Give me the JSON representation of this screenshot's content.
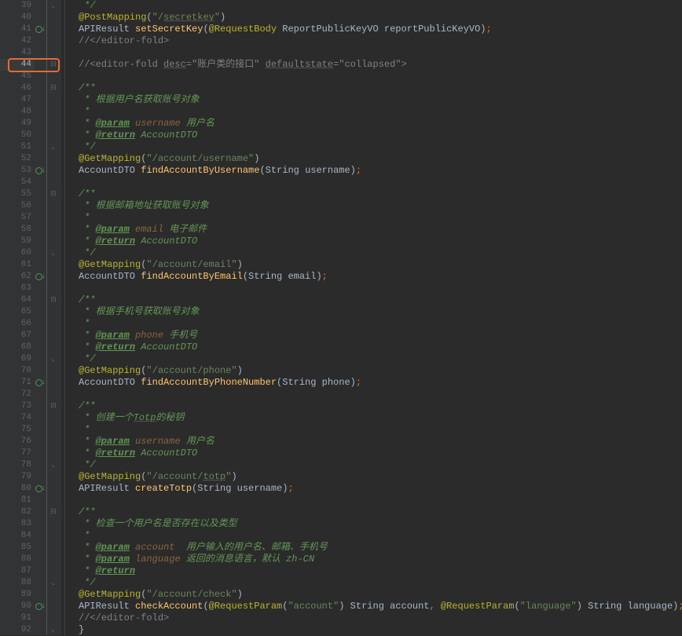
{
  "highlighted_line": 44,
  "lines": [
    {
      "n": 39,
      "fold": "end",
      "indent": 2,
      "tokens": [
        {
          "t": " */",
          "c": "c-doc"
        }
      ]
    },
    {
      "n": 40,
      "marker": false,
      "indent": 1,
      "tokens": [
        {
          "t": "@PostMapping",
          "c": "c-anno"
        },
        {
          "t": "(",
          "c": ""
        },
        {
          "t": "\"/",
          "c": "c-string"
        },
        {
          "t": "secretkey",
          "c": "c-string c-underline"
        },
        {
          "t": "\"",
          "c": "c-string"
        },
        {
          "t": ")",
          "c": ""
        }
      ]
    },
    {
      "n": 41,
      "marker": true,
      "indent": 1,
      "tokens": [
        {
          "t": "APIResult ",
          "c": ""
        },
        {
          "t": "setSecretKey",
          "c": "c-method"
        },
        {
          "t": "(",
          "c": ""
        },
        {
          "t": "@RequestBody",
          "c": "c-anno"
        },
        {
          "t": " ReportPublicKeyVO reportPublicKeyVO)",
          "c": ""
        },
        {
          "t": ";",
          "c": "c-sc"
        }
      ]
    },
    {
      "n": 42,
      "indent": 1,
      "tokens": [
        {
          "t": "//</editor-fold>",
          "c": "c-comment"
        }
      ]
    },
    {
      "n": 43,
      "indent": 1,
      "tokens": []
    },
    {
      "n": 44,
      "fold": "start",
      "indent": 1,
      "tokens": [
        {
          "t": "//<editor-fold ",
          "c": "c-comment"
        },
        {
          "t": "desc",
          "c": "c-comment c-underline"
        },
        {
          "t": "=\"账户类的接口\" ",
          "c": "c-comment"
        },
        {
          "t": "defaultstate",
          "c": "c-comment c-underline"
        },
        {
          "t": "=\"collapsed\">",
          "c": "c-comment"
        }
      ]
    },
    {
      "n": 45,
      "indent": 1,
      "tokens": []
    },
    {
      "n": 46,
      "fold": "start",
      "indent": 1,
      "tokens": [
        {
          "t": "/**",
          "c": "c-doc"
        }
      ]
    },
    {
      "n": 47,
      "indent": 2,
      "tokens": [
        {
          "t": " * 根据用户名获取账号对象",
          "c": "c-doc"
        }
      ]
    },
    {
      "n": 48,
      "indent": 2,
      "tokens": [
        {
          "t": " *",
          "c": "c-doc"
        }
      ]
    },
    {
      "n": 49,
      "indent": 2,
      "tokens": [
        {
          "t": " * ",
          "c": "c-doc"
        },
        {
          "t": "@param",
          "c": "c-doctag"
        },
        {
          "t": " ",
          "c": "c-doc"
        },
        {
          "t": "username",
          "c": "c-docparam"
        },
        {
          "t": " 用户名",
          "c": "c-doc"
        }
      ]
    },
    {
      "n": 50,
      "indent": 2,
      "tokens": [
        {
          "t": " * ",
          "c": "c-doc"
        },
        {
          "t": "@return",
          "c": "c-doctag"
        },
        {
          "t": " AccountDTO",
          "c": "c-doc"
        }
      ]
    },
    {
      "n": 51,
      "fold": "end",
      "indent": 2,
      "tokens": [
        {
          "t": " */",
          "c": "c-doc"
        }
      ]
    },
    {
      "n": 52,
      "indent": 1,
      "tokens": [
        {
          "t": "@GetMapping",
          "c": "c-anno"
        },
        {
          "t": "(",
          "c": ""
        },
        {
          "t": "\"/account/username\"",
          "c": "c-string"
        },
        {
          "t": ")",
          "c": ""
        }
      ]
    },
    {
      "n": 53,
      "marker": true,
      "indent": 1,
      "tokens": [
        {
          "t": "AccountDTO ",
          "c": ""
        },
        {
          "t": "findAccountByUsername",
          "c": "c-method"
        },
        {
          "t": "(String username)",
          "c": ""
        },
        {
          "t": ";",
          "c": "c-sc"
        }
      ]
    },
    {
      "n": 54,
      "indent": 1,
      "tokens": []
    },
    {
      "n": 55,
      "fold": "start",
      "indent": 1,
      "tokens": [
        {
          "t": "/**",
          "c": "c-doc"
        }
      ]
    },
    {
      "n": 56,
      "indent": 2,
      "tokens": [
        {
          "t": " * 根据邮箱地址获取账号对象",
          "c": "c-doc"
        }
      ]
    },
    {
      "n": 57,
      "indent": 2,
      "tokens": [
        {
          "t": " *",
          "c": "c-doc"
        }
      ]
    },
    {
      "n": 58,
      "indent": 2,
      "tokens": [
        {
          "t": " * ",
          "c": "c-doc"
        },
        {
          "t": "@param",
          "c": "c-doctag"
        },
        {
          "t": " ",
          "c": "c-doc"
        },
        {
          "t": "email",
          "c": "c-docparam"
        },
        {
          "t": " 电子邮件",
          "c": "c-doc"
        }
      ]
    },
    {
      "n": 59,
      "indent": 2,
      "tokens": [
        {
          "t": " * ",
          "c": "c-doc"
        },
        {
          "t": "@return",
          "c": "c-doctag"
        },
        {
          "t": " AccountDTO",
          "c": "c-doc"
        }
      ]
    },
    {
      "n": 60,
      "fold": "end",
      "indent": 2,
      "tokens": [
        {
          "t": " */",
          "c": "c-doc"
        }
      ]
    },
    {
      "n": 61,
      "indent": 1,
      "tokens": [
        {
          "t": "@GetMapping",
          "c": "c-anno"
        },
        {
          "t": "(",
          "c": ""
        },
        {
          "t": "\"/account/email\"",
          "c": "c-string"
        },
        {
          "t": ")",
          "c": ""
        }
      ]
    },
    {
      "n": 62,
      "marker": true,
      "indent": 1,
      "tokens": [
        {
          "t": "AccountDTO ",
          "c": ""
        },
        {
          "t": "findAccountByEmail",
          "c": "c-method"
        },
        {
          "t": "(String email)",
          "c": ""
        },
        {
          "t": ";",
          "c": "c-sc"
        }
      ]
    },
    {
      "n": 63,
      "indent": 1,
      "tokens": []
    },
    {
      "n": 64,
      "fold": "start",
      "indent": 1,
      "tokens": [
        {
          "t": "/**",
          "c": "c-doc"
        }
      ]
    },
    {
      "n": 65,
      "indent": 2,
      "tokens": [
        {
          "t": " * 根据手机号获取账号对象",
          "c": "c-doc"
        }
      ]
    },
    {
      "n": 66,
      "indent": 2,
      "tokens": [
        {
          "t": " *",
          "c": "c-doc"
        }
      ]
    },
    {
      "n": 67,
      "indent": 2,
      "tokens": [
        {
          "t": " * ",
          "c": "c-doc"
        },
        {
          "t": "@param",
          "c": "c-doctag"
        },
        {
          "t": " ",
          "c": "c-doc"
        },
        {
          "t": "phone",
          "c": "c-docparam"
        },
        {
          "t": " 手机号",
          "c": "c-doc"
        }
      ]
    },
    {
      "n": 68,
      "indent": 2,
      "tokens": [
        {
          "t": " * ",
          "c": "c-doc"
        },
        {
          "t": "@return",
          "c": "c-doctag"
        },
        {
          "t": " AccountDTO",
          "c": "c-doc"
        }
      ]
    },
    {
      "n": 69,
      "fold": "end",
      "indent": 2,
      "tokens": [
        {
          "t": " */",
          "c": "c-doc"
        }
      ]
    },
    {
      "n": 70,
      "indent": 1,
      "tokens": [
        {
          "t": "@GetMapping",
          "c": "c-anno"
        },
        {
          "t": "(",
          "c": ""
        },
        {
          "t": "\"/account/phone\"",
          "c": "c-string"
        },
        {
          "t": ")",
          "c": ""
        }
      ]
    },
    {
      "n": 71,
      "marker": true,
      "indent": 1,
      "tokens": [
        {
          "t": "AccountDTO ",
          "c": ""
        },
        {
          "t": "findAccountByPhoneNumber",
          "c": "c-method"
        },
        {
          "t": "(String phone)",
          "c": ""
        },
        {
          "t": ";",
          "c": "c-sc"
        }
      ]
    },
    {
      "n": 72,
      "indent": 1,
      "tokens": []
    },
    {
      "n": 73,
      "fold": "start",
      "indent": 1,
      "tokens": [
        {
          "t": "/**",
          "c": "c-doc"
        }
      ]
    },
    {
      "n": 74,
      "indent": 2,
      "tokens": [
        {
          "t": " * 创建一个",
          "c": "c-doc"
        },
        {
          "t": "Totp",
          "c": "c-doc c-underline"
        },
        {
          "t": "的秘钥",
          "c": "c-doc"
        }
      ]
    },
    {
      "n": 75,
      "indent": 2,
      "tokens": [
        {
          "t": " *",
          "c": "c-doc"
        }
      ]
    },
    {
      "n": 76,
      "indent": 2,
      "tokens": [
        {
          "t": " * ",
          "c": "c-doc"
        },
        {
          "t": "@param",
          "c": "c-doctag"
        },
        {
          "t": " ",
          "c": "c-doc"
        },
        {
          "t": "username",
          "c": "c-docparam"
        },
        {
          "t": " 用户名",
          "c": "c-doc"
        }
      ]
    },
    {
      "n": 77,
      "indent": 2,
      "tokens": [
        {
          "t": " * ",
          "c": "c-doc"
        },
        {
          "t": "@return",
          "c": "c-doctag"
        },
        {
          "t": " AccountDTO",
          "c": "c-doc"
        }
      ]
    },
    {
      "n": 78,
      "fold": "end",
      "indent": 2,
      "tokens": [
        {
          "t": " */",
          "c": "c-doc"
        }
      ]
    },
    {
      "n": 79,
      "indent": 1,
      "tokens": [
        {
          "t": "@GetMapping",
          "c": "c-anno"
        },
        {
          "t": "(",
          "c": ""
        },
        {
          "t": "\"/account/",
          "c": "c-string"
        },
        {
          "t": "totp",
          "c": "c-string c-underline"
        },
        {
          "t": "\"",
          "c": "c-string"
        },
        {
          "t": ")",
          "c": ""
        }
      ]
    },
    {
      "n": 80,
      "marker": true,
      "indent": 1,
      "tokens": [
        {
          "t": "APIResult ",
          "c": ""
        },
        {
          "t": "createTotp",
          "c": "c-method"
        },
        {
          "t": "(String username)",
          "c": ""
        },
        {
          "t": ";",
          "c": "c-sc"
        }
      ]
    },
    {
      "n": 81,
      "indent": 1,
      "tokens": []
    },
    {
      "n": 82,
      "fold": "start",
      "indent": 1,
      "tokens": [
        {
          "t": "/**",
          "c": "c-doc"
        }
      ]
    },
    {
      "n": 83,
      "indent": 2,
      "tokens": [
        {
          "t": " * 检查一个用户名是否存在以及类型",
          "c": "c-doc"
        }
      ]
    },
    {
      "n": 84,
      "indent": 2,
      "tokens": [
        {
          "t": " *",
          "c": "c-doc"
        }
      ]
    },
    {
      "n": 85,
      "indent": 2,
      "tokens": [
        {
          "t": " * ",
          "c": "c-doc"
        },
        {
          "t": "@param",
          "c": "c-doctag"
        },
        {
          "t": " ",
          "c": "c-doc"
        },
        {
          "t": "account",
          "c": "c-docparam"
        },
        {
          "t": "  用户输入的用户名、邮箱、手机号",
          "c": "c-doc"
        }
      ]
    },
    {
      "n": 86,
      "indent": 2,
      "tokens": [
        {
          "t": " * ",
          "c": "c-doc"
        },
        {
          "t": "@param",
          "c": "c-doctag"
        },
        {
          "t": " ",
          "c": "c-doc"
        },
        {
          "t": "language",
          "c": "c-docparam"
        },
        {
          "t": " 返回的消息语言，默认 zh-CN",
          "c": "c-doc"
        }
      ]
    },
    {
      "n": 87,
      "indent": 2,
      "tokens": [
        {
          "t": " * ",
          "c": "c-doc"
        },
        {
          "t": "@return",
          "c": "c-doctag"
        }
      ]
    },
    {
      "n": 88,
      "fold": "end",
      "indent": 2,
      "tokens": [
        {
          "t": " */",
          "c": "c-doc"
        }
      ]
    },
    {
      "n": 89,
      "indent": 1,
      "tokens": [
        {
          "t": "@GetMapping",
          "c": "c-anno"
        },
        {
          "t": "(",
          "c": ""
        },
        {
          "t": "\"/account/check\"",
          "c": "c-string"
        },
        {
          "t": ")",
          "c": ""
        }
      ]
    },
    {
      "n": 90,
      "marker": true,
      "indent": 1,
      "tokens": [
        {
          "t": "APIResult ",
          "c": ""
        },
        {
          "t": "checkAccount",
          "c": "c-method"
        },
        {
          "t": "(",
          "c": ""
        },
        {
          "t": "@RequestParam",
          "c": "c-anno"
        },
        {
          "t": "(",
          "c": ""
        },
        {
          "t": "\"account\"",
          "c": "c-string"
        },
        {
          "t": ") String account",
          "c": ""
        },
        {
          "t": ", ",
          "c": "c-sc"
        },
        {
          "t": "@RequestParam",
          "c": "c-anno"
        },
        {
          "t": "(",
          "c": ""
        },
        {
          "t": "\"language\"",
          "c": "c-string"
        },
        {
          "t": ") String language)",
          "c": ""
        },
        {
          "t": ";",
          "c": "c-sc"
        }
      ]
    },
    {
      "n": 91,
      "indent": 1,
      "tokens": [
        {
          "t": "//</editor-fold>",
          "c": "c-comment"
        }
      ]
    },
    {
      "n": 92,
      "fold": "end",
      "indent": 0,
      "tokens": [
        {
          "t": "}",
          "c": ""
        }
      ]
    }
  ]
}
